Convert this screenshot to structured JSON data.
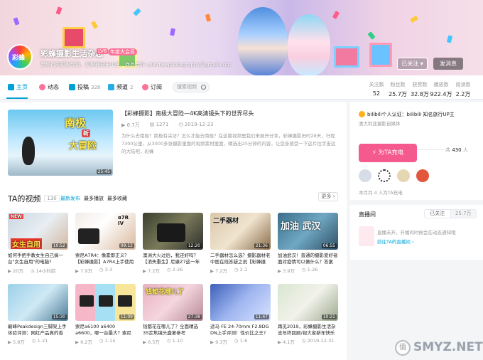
{
  "header": {
    "username": "彩蜂摄影生活杂志",
    "level": "LV6",
    "vip_badge": "年度大会员",
    "avatar_text": "彩蜂",
    "signature": "聚焦行的摄影频道、摄影器材击中医、商务合作 colorbeephotography@gmail.com",
    "follow_label": "已关注",
    "follow_caret": "▾",
    "message_label": "发消息"
  },
  "nav": {
    "tabs": [
      {
        "label": "主页",
        "count": ""
      },
      {
        "label": "动态",
        "count": ""
      },
      {
        "label": "投稿",
        "count": "328"
      },
      {
        "label": "频道",
        "count": "2"
      },
      {
        "label": "订阅",
        "count": ""
      }
    ],
    "search_placeholder": "搜索视频",
    "stats": [
      {
        "label": "关注数",
        "value": "52"
      },
      {
        "label": "粉丝数",
        "value": "25.7万"
      },
      {
        "label": "获赞数",
        "value": "32.8万"
      },
      {
        "label": "播放数",
        "value": "922.4万"
      },
      {
        "label": "阅读数",
        "value": "2.2万"
      }
    ]
  },
  "featured": {
    "title": "【彩蜂摄影】南极大冒险—4K高清镜头下的世界尽头",
    "plays": "6.7万",
    "danmaku": "1271",
    "date": "2019-12-23",
    "desc": "为什么去南极？南极有采访？怎么才能去南极？在这篇视频里我们来展开分享，彩蜂摄影历时28天，行程7300公里，从3000多张摄影里面的视频素材里面，精选出25分钟的内容，让您身感受一下这片拉宇宙远的大陆吧，彩蜂",
    "thumb_text_1": "南极",
    "thumb_text_2": "大冒险",
    "thumb_badge": "新",
    "duration": "25:45"
  },
  "videos_section": {
    "title": "TA的视频",
    "count": "130",
    "sort_options": [
      "最新发布",
      "最多播放",
      "最多收藏"
    ],
    "more_label": "更多"
  },
  "videos": [
    {
      "title": "如何手把手教女生自己搞一台\"女生自用\"的电脑?",
      "plays": "20万",
      "date": "14小时前",
      "duration": "10:52",
      "overlay": "女生自用",
      "tag": "NEW"
    },
    {
      "title": "索尼A7R4：像素即正义？【彩蜂摄影】A7R4上手使用",
      "plays": "7.9万",
      "date": "3-3",
      "duration": "09:12",
      "overlay": "α7R IV"
    },
    {
      "title": "澳洲大火过后，我还好吗？【消失重生】尼康Z7这一年到底",
      "plays": "7.2万",
      "date": "2-26",
      "duration": "12:20",
      "overlay": ""
    },
    {
      "title": "二手器材怎么选？摄影器材老中医在线答疑之说【彩蜂摄影】",
      "plays": "7.2万",
      "date": "2-1",
      "duration": "21:36",
      "overlay": "二手器材"
    },
    {
      "title": "加油武汉！普通的摄影爱好者面对疫情可以做什么？答案",
      "plays": "3.9万",
      "date": "1-26",
      "duration": "06:55",
      "overlay": "加油 武汉"
    },
    {
      "title": "巅峰Peakdesign三脚架上手体验评测：网红产品真的香",
      "plays": "5.8万",
      "date": "1-21",
      "duration": "15:30",
      "overlay": ""
    },
    {
      "title": "索尼a6100 a6400 a6600，哪一台最大？索尼Apsc相机选购",
      "plays": "9.2万",
      "date": "1-14",
      "duration": "11:09",
      "overlay": ""
    },
    {
      "title": "钱都花在哪儿了？全面精选35定焦镜头盛宴参考",
      "plays": "6.5万",
      "date": "1-10",
      "duration": "27:38",
      "overlay": "钱都花哪儿了"
    },
    {
      "title": "适马 FE 24-70mm F2.8DG DN上手评测！性价比之王?",
      "plays": "9.3万",
      "date": "1-6",
      "duration": "11:47",
      "overlay": ""
    },
    {
      "title": "再见2019，彩蜂摄影生活杂志年终回顾/视大家新年快乐",
      "plays": "4.1万",
      "date": "2019-12-31",
      "duration": "10:21",
      "overlay": ""
    }
  ],
  "sidebar": {
    "cert": "bilibili个人认证：bilibili 知名旅行UP主",
    "cert_sub": "澳大利亚摄影自媒体",
    "charge_label": "为TA充电",
    "charge_count_prefix": "共",
    "charge_count": "430",
    "charge_count_suffix": "人",
    "charge_month": "本月共 4 人为TA充电",
    "live_title": "直播间",
    "live_follow": "已关注",
    "live_fans": "25.7万",
    "live_status": "直播未开，开播的时候会在动态通知哦",
    "live_link": "前往TA的直播间 ›"
  },
  "watermark": "SMYZ.NET",
  "watermark_sub": "值"
}
